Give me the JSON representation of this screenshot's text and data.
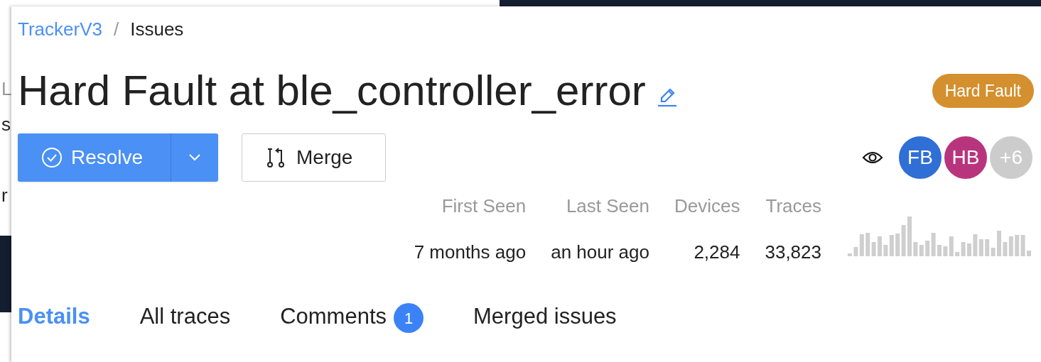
{
  "background_window": {
    "fragments": [
      "L",
      "s",
      "r"
    ]
  },
  "breadcrumb": {
    "items": [
      "TrackerV3",
      "Issues"
    ],
    "separator": "/"
  },
  "issue": {
    "title": "Hard Fault at ble_controller_error",
    "badge": "Hard Fault"
  },
  "actions": {
    "resolve": "Resolve",
    "merge": "Merge"
  },
  "watchers": [
    {
      "initials": "FB",
      "color": "#2f6fd6"
    },
    {
      "initials": "HB",
      "color": "#b8357e"
    },
    {
      "initials": "+6",
      "color": "#cccccc"
    }
  ],
  "stats": [
    {
      "label": "First Seen",
      "value": "7 months ago"
    },
    {
      "label": "Last Seen",
      "value": "an hour ago"
    },
    {
      "label": "Devices",
      "value": "2,284"
    },
    {
      "label": "Traces",
      "value": "33,823"
    }
  ],
  "tabs": [
    {
      "label": "Details",
      "selected": true
    },
    {
      "label": "All traces",
      "selected": false
    },
    {
      "label": "Comments",
      "selected": false,
      "count": "1"
    },
    {
      "label": "Merged issues",
      "selected": false
    }
  ]
}
